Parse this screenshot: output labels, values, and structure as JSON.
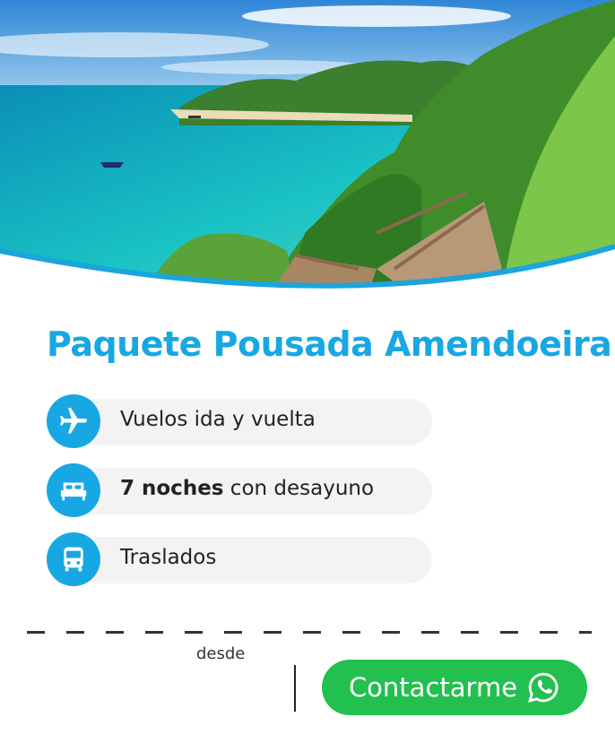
{
  "package": {
    "title": "Paquete Pousada Amendoeira"
  },
  "features": [
    {
      "icon": "airplane-icon",
      "label": "Vuelos ida y vuelta"
    },
    {
      "icon": "bed-icon",
      "label_bold": "7 noches",
      "label": " con desayuno"
    },
    {
      "icon": "bus-icon",
      "label": "Traslados"
    }
  ],
  "price": {
    "prefix": "desde"
  },
  "cta": {
    "label": "Contactarme",
    "icon": "whatsapp-icon"
  },
  "colors": {
    "accent": "#17a8e3",
    "cta": "#22c04f",
    "pill": "#f3f3f3"
  }
}
